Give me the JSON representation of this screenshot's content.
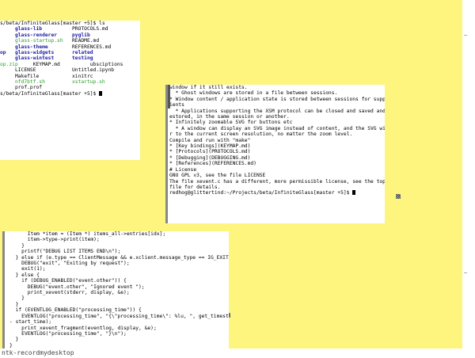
{
  "terminal_ls": {
    "lines": [
      {
        "segs": [
          {
            "t": "s/beta/InfiniteGlass[master +5]$ ls",
            "c": ""
          }
        ]
      },
      {
        "segs": [
          {
            "t": "     glass-lib          ",
            "c": "b"
          },
          {
            "t": "PROTOCOLS.md",
            "c": ""
          }
        ]
      },
      {
        "segs": [
          {
            "t": "     glass-renderer     ",
            "c": "b"
          },
          {
            "t": "pyglib",
            "c": "b"
          }
        ]
      },
      {
        "segs": [
          {
            "t": "     glass-startup.sh   ",
            "c": "g"
          },
          {
            "t": "README.md",
            "c": ""
          }
        ]
      },
      {
        "segs": [
          {
            "t": "     glass-theme        ",
            "c": "b"
          },
          {
            "t": "REFERENCES.md",
            "c": ""
          }
        ]
      },
      {
        "segs": [
          {
            "t": "op   ",
            "c": "b"
          },
          {
            "t": "glass-widgets      ",
            "c": "b"
          },
          {
            "t": "related",
            "c": "b"
          }
        ]
      },
      {
        "segs": [
          {
            "t": "     glass-wintest      ",
            "c": "b"
          },
          {
            "t": "testing",
            "c": "b"
          }
        ]
      },
      {
        "segs": [
          {
            "t": "op.zip",
            "c": "g"
          },
          {
            "t": "     KEYMAP.md          ubsciptions",
            "c": ""
          }
        ]
      },
      {
        "segs": [
          {
            "t": "     LICENSE            Untitled.ipynb",
            "c": ""
          }
        ]
      },
      {
        "segs": [
          {
            "t": "     Makefile           xinitrc",
            "c": ""
          }
        ]
      },
      {
        "segs": [
          {
            "t": "     nfd7btf.sh         ",
            "c": "g"
          },
          {
            "t": "xstartup.sh",
            "c": "g"
          }
        ]
      },
      {
        "segs": [
          {
            "t": "     prof.prof",
            "c": ""
          }
        ]
      },
      {
        "segs": [
          {
            "t": "s/beta/InfiniteGlass[master +5]$ ",
            "c": ""
          }
        ],
        "cursor": true
      }
    ]
  },
  "terminal_readme": {
    "lines": [
      "window if it still exists.",
      "  * Ghost windows are stored in a file between sessions.",
      "* Window content / application state is stored between sessions for supported cl",
      "ients",
      "  * Applications supporting the XSM protocol can be closed and saved and later r",
      "estored, in the same session or another.",
      "* Infinitely zoomable SVG for buttons etc",
      "  * A window can display an SVG image instead of content, and the SVG will rende",
      "r to the current screen resolution, no matter the zoom level.",
      "",
      "Compile and run with \"make\"",
      "",
      "* [Key bindings](KEYMAP.md)",
      "* [Protocols](PROTOCOLS.md)",
      "* [Debugging](DEBUGGING.md)",
      "* [References](REFERENCES.md)",
      "",
      "# License",
      "",
      "GNU GPL v3, see the file LICENSE",
      "",
      "The file xevent.c has a different, more permissible license, see the top of the",
      "file for details.",
      "redhog@glittertind:~/Projects/beta/InfiniteGlass[master +5]$ "
    ]
  },
  "terminal_code": {
    "lines": [
      "      Item *item = (Item *) items_all->entries[idx];",
      "      item->type->print(item);",
      "    }",
      "    printf(\"DEBUG LIST ITEMS END\\n\");",
      "  } else if (e.type == ClientMessage && e.xclient.message_type == IG_EXIT) {",
      "    DEBUG(\"exit\", \"Exiting by request\");",
      "    exit(1);",
      "  } else {",
      "    if (DEBUG_ENABLED(\"event.other\")) {",
      "      DEBUG(\"event.other\", \"Ignored event \");",
      "      print_xevent(stderr, display, &e);",
      "    }",
      "  }",
      "",
      "  if (EVENTLOG_ENABLED(\"processing_time\")) {",
      "    EVENTLOG(\"processing_time\", \"{\\\"processing_time\\\": %lu, \", get_timestamp()",
      "- start_time);",
      "    print_xevent_fragment(eventlog, display, &e);",
      "    EVENTLOG(\"processing_time\", \"}\\n\");",
      "  }",
      "}"
    ]
  },
  "bottom_text": "ntk-recordmydesktop",
  "colors": {
    "desktop": "#fdf57e",
    "dir": "#1a1aa6",
    "exec": "#2a9d2a"
  }
}
